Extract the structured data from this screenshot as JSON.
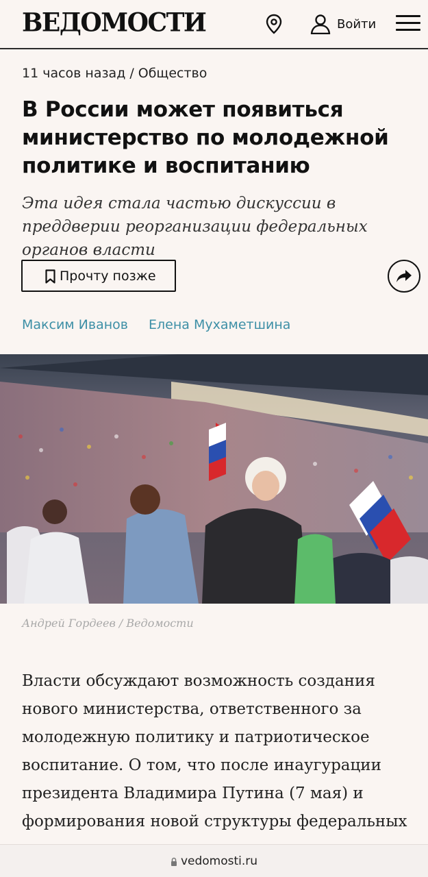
{
  "header": {
    "logo": "ВЕДОМОСТИ",
    "login_label": "Войти"
  },
  "article": {
    "time": "11 часов назад",
    "separator": "/",
    "section": "Общество",
    "title": "В России может появиться министерство по молодежной политике и воспитанию",
    "subtitle": "Эта идея стала частью дискуссии в преддверии реорганизации федеральных органов власти",
    "read_later_label": "Прочту позже",
    "authors": [
      "Максим Иванов",
      "Елена Мухаметшина"
    ],
    "photo_credit": "Андрей Гордеев / Ведомости",
    "body": "Власти обсуждают возможность создания нового министерства, ответственного за молодежную политику и патриотическое воспитание. О том, что после инаугурации президента Владимира Путина (7 мая) и формирования новой структуры федеральных"
  },
  "browser": {
    "url": "vedomosti.ru"
  },
  "icons": {
    "location": "location-pin-icon",
    "user": "user-icon",
    "menu": "hamburger-menu-icon",
    "bookmark": "bookmark-icon",
    "share": "share-arrow-icon",
    "lock": "lock-icon"
  },
  "colors": {
    "background": "#faf5f2",
    "author_link": "#3d8fa6",
    "credit": "#a8a8a8"
  }
}
